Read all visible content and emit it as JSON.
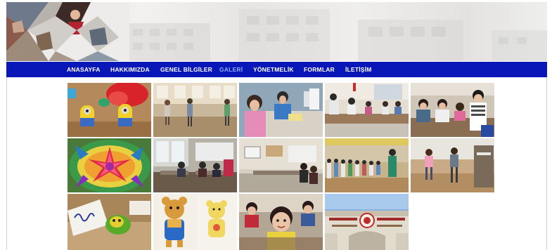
{
  "nav": {
    "items": [
      {
        "label": "ANASAYFA"
      },
      {
        "label": "HAKKIMIZDA"
      },
      {
        "label": "GENEL BİLGİLER"
      },
      {
        "label": "GALERİ"
      },
      {
        "label": "YÖNETMELİK"
      },
      {
        "label": "FORMLAR"
      },
      {
        "label": "İLETİŞİM"
      }
    ],
    "active": "GALERİ",
    "background": "#0a17b8",
    "active_color": "#8fa8ff"
  },
  "gallery": {
    "photos": [
      {
        "subject": "clay-minion-figures"
      },
      {
        "subject": "children-dancing-in-hall"
      },
      {
        "subject": "girls-crafting-at-table"
      },
      {
        "subject": "classroom-activity"
      },
      {
        "subject": "teacher-with-students"
      },
      {
        "subject": "colored-sand-art-flower"
      },
      {
        "subject": "students-at-desks"
      },
      {
        "subject": "classroom-with-whiteboard"
      },
      {
        "subject": "children-lined-up-in-gym"
      },
      {
        "subject": "girls-playing-in-gym"
      },
      {
        "subject": "clay-craft-with-name-card"
      },
      {
        "subject": "cartoon-bear-drawings"
      },
      {
        "subject": "boy-in-classroom"
      },
      {
        "subject": "school-building-entrance"
      }
    ]
  }
}
